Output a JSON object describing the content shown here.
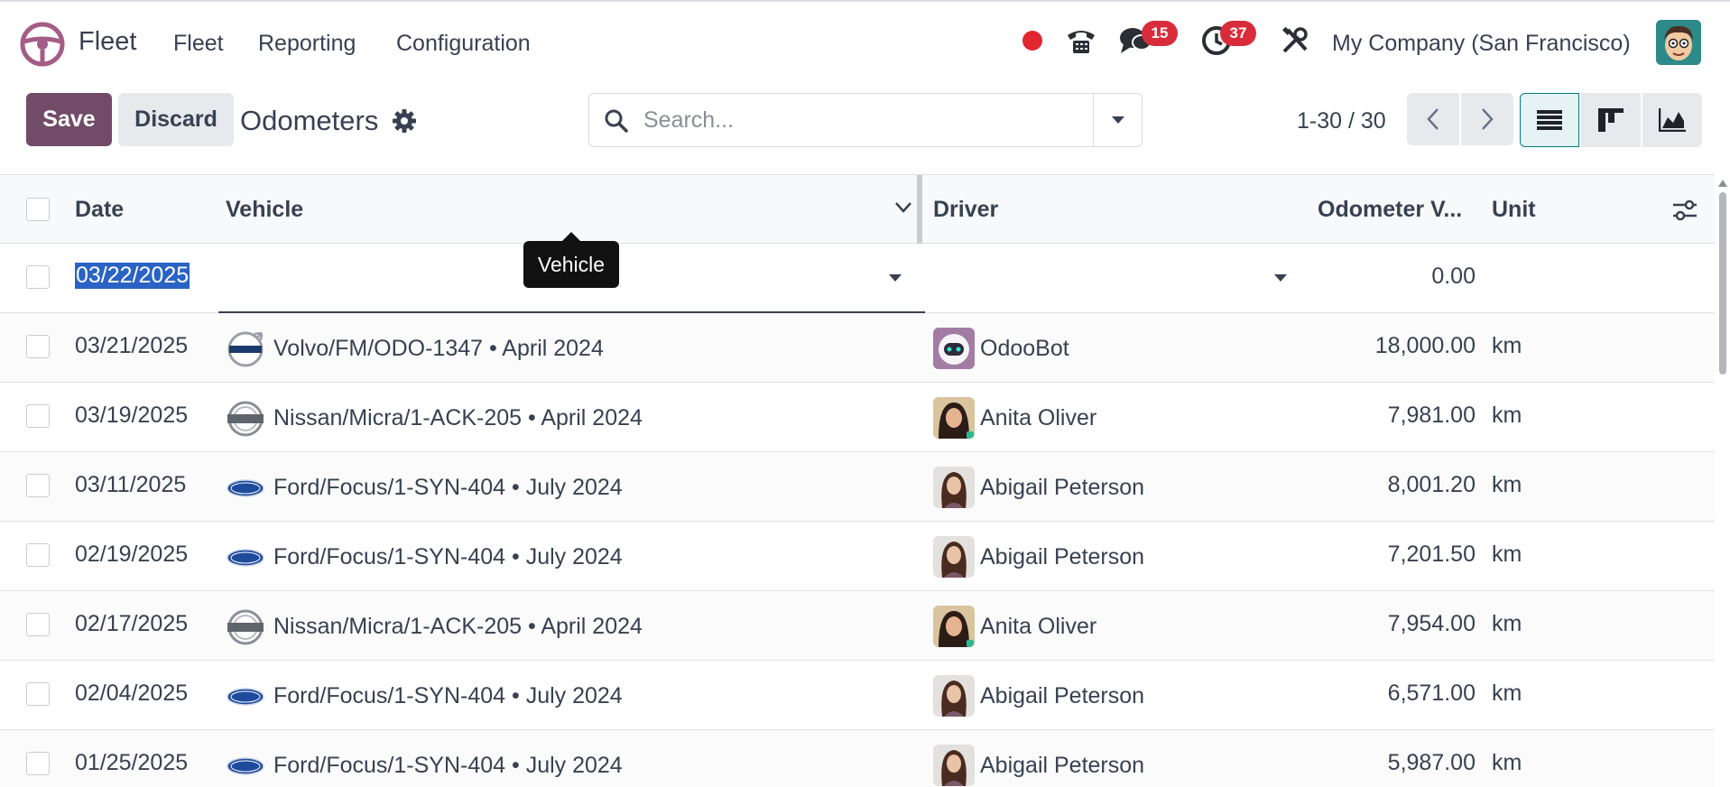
{
  "app": {
    "name": "Fleet",
    "menus": [
      "Fleet",
      "Reporting",
      "Configuration"
    ],
    "company": "My Company (San Francisco)",
    "chat_count": "15",
    "activity_count": "37"
  },
  "toolbar": {
    "save_label": "Save",
    "discard_label": "Discard",
    "title": "Odometers"
  },
  "search": {
    "placeholder": "Search..."
  },
  "pager": {
    "text": "1-30 / 30"
  },
  "table": {
    "columns": [
      "Date",
      "Vehicle",
      "Driver",
      "Odometer V...",
      "Unit"
    ],
    "new_row": {
      "date": "03/22/2025",
      "value": "0.00"
    },
    "tooltip": "Vehicle",
    "rows": [
      {
        "date": "03/21/2025",
        "vehicle": "Volvo/FM/ODO-1347 • April 2024",
        "brand": "volvo",
        "driver": "OdooBot",
        "value": "18,000.00",
        "unit": "km"
      },
      {
        "date": "03/19/2025",
        "vehicle": "Nissan/Micra/1-ACK-205 • April 2024",
        "brand": "nissan",
        "driver": "Anita Oliver",
        "value": "7,981.00",
        "unit": "km"
      },
      {
        "date": "03/11/2025",
        "vehicle": "Ford/Focus/1-SYN-404 • July 2024",
        "brand": "ford",
        "driver": "Abigail Peterson",
        "value": "8,001.20",
        "unit": "km"
      },
      {
        "date": "02/19/2025",
        "vehicle": "Ford/Focus/1-SYN-404 • July 2024",
        "brand": "ford",
        "driver": "Abigail Peterson",
        "value": "7,201.50",
        "unit": "km"
      },
      {
        "date": "02/17/2025",
        "vehicle": "Nissan/Micra/1-ACK-205 • April 2024",
        "brand": "nissan",
        "driver": "Anita Oliver",
        "value": "7,954.00",
        "unit": "km"
      },
      {
        "date": "02/04/2025",
        "vehicle": "Ford/Focus/1-SYN-404 • July 2024",
        "brand": "ford",
        "driver": "Abigail Peterson",
        "value": "6,571.00",
        "unit": "km"
      },
      {
        "date": "01/25/2025",
        "vehicle": "Ford/Focus/1-SYN-404 • July 2024",
        "brand": "ford",
        "driver": "Abigail Peterson",
        "value": "5,987.00",
        "unit": "km"
      }
    ]
  },
  "colors": {
    "primary": "#714b67",
    "accent": "#017e84",
    "badge": "#d92c3a",
    "recording": "#e0262f"
  }
}
